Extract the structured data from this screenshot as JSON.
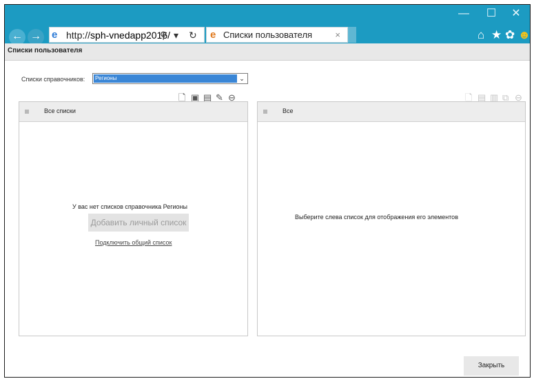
{
  "browser": {
    "url_scheme": "http://",
    "url_host": "sph-vnedapp2016/",
    "tab_title": "Списки пользователя",
    "tab_close": "×",
    "window_controls": {
      "minimize": "—",
      "maximize": "☐",
      "close": "✕"
    },
    "nav": {
      "back": "←",
      "forward": "→"
    },
    "address_tools": {
      "search": "⚲",
      "dropdown": "▾",
      "refresh": "↻"
    },
    "toolbar_icons": {
      "home": "⌂",
      "favorites": "★",
      "settings": "✿",
      "smiley": "☻"
    },
    "colors": {
      "titlebar": "#1c9bc2"
    }
  },
  "page": {
    "title": "Списки пользователя",
    "directory_label": "Списки справочников:",
    "directory_value": "Регионы",
    "dropdown_arrow": "⌄"
  },
  "left_panel": {
    "header": "Все списки",
    "empty_message": "У вас нет списков справочника Регионы",
    "add_button": "Добавить личный список",
    "connect_link": "Подключить общий список",
    "toolbar_icons": [
      "new-document-icon",
      "import-icon",
      "rename-icon",
      "edit-icon",
      "remove-icon"
    ]
  },
  "right_panel": {
    "header": "Все",
    "empty_message": "Выберите слева список для отображения его элементов",
    "toolbar_icons": [
      "new-item-icon",
      "text-icon",
      "copy-icon",
      "move-icon",
      "remove-icon"
    ]
  },
  "footer": {
    "close_button": "Закрыть"
  }
}
